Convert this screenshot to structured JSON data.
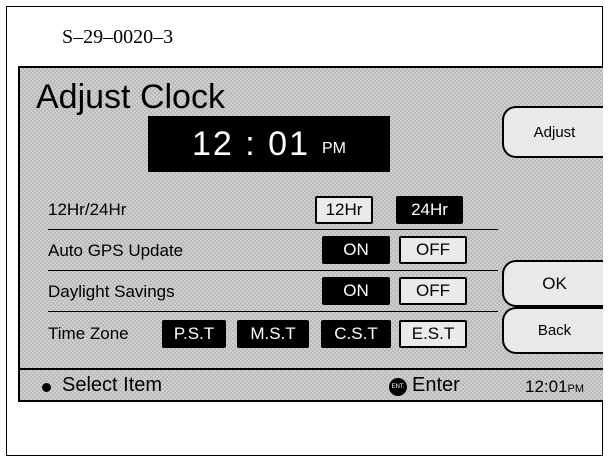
{
  "figure_label": "S–29–0020–3",
  "screen": {
    "title": "Adjust Clock",
    "time": "12 : 01",
    "ampm": "PM"
  },
  "side_buttons": {
    "adjust": "Adjust",
    "ok": "OK",
    "back": "Back"
  },
  "settings": {
    "hour_format": {
      "label": "12Hr/24Hr",
      "opt1": "12Hr",
      "opt2": "24Hr"
    },
    "auto_gps": {
      "label": "Auto GPS Update",
      "on": "ON",
      "off": "OFF"
    },
    "daylight": {
      "label": "Daylight Savings",
      "on": "ON",
      "off": "OFF"
    },
    "time_zone": {
      "label": "Time Zone",
      "zones": [
        "P.S.T",
        "M.S.T",
        "C.S.T",
        "E.S.T"
      ]
    }
  },
  "status_bar": {
    "select_item": "Select Item",
    "enter_icon": "ENT.",
    "enter_label": "Enter",
    "clock": "12:01",
    "clock_ampm": "PM"
  }
}
